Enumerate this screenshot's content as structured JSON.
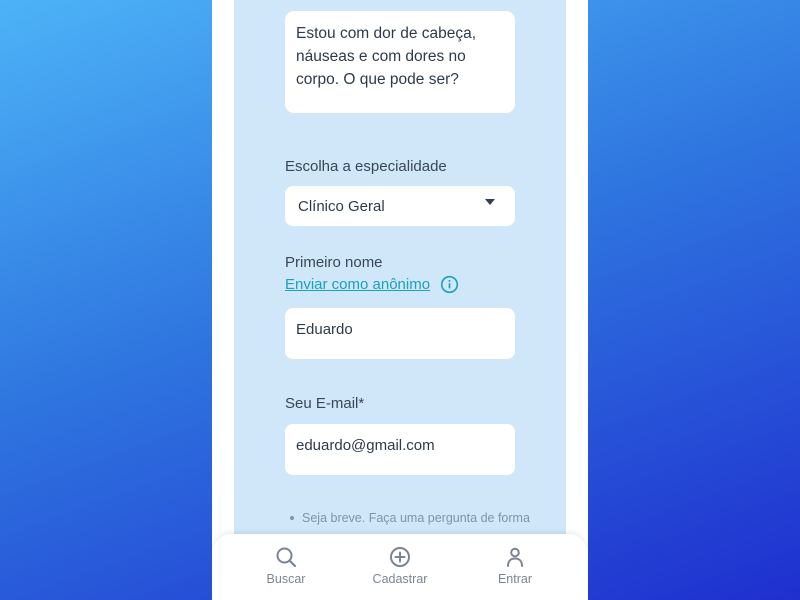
{
  "form": {
    "question_text": "Estou com dor de cabeça, náuseas e com dores no corpo. O que pode ser?",
    "specialty_label": "Escolha a especialidade",
    "specialty_value": "Clínico Geral",
    "first_name_label": "Primeiro nome",
    "anonymous_link": "Enviar como anônimo",
    "first_name_value": "Eduardo",
    "email_label": "Seu E-mail*",
    "email_value": "eduardo@gmail.com",
    "hint_text": "Seja breve. Faça uma pergunta de forma"
  },
  "nav": {
    "items": [
      {
        "label": "Buscar",
        "icon": "search-icon"
      },
      {
        "label": "Cadastrar",
        "icon": "plus-circle-icon"
      },
      {
        "label": "Entrar",
        "icon": "user-icon"
      }
    ]
  },
  "colors": {
    "panel": "#cfe7f8",
    "link": "#1aa0c0",
    "background_start": "#4db3f7",
    "background_end": "#1f2fcf"
  }
}
